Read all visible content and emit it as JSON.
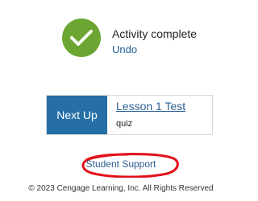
{
  "status": {
    "icon": "checkmark-icon",
    "title": "Activity complete",
    "undo_label": "Undo",
    "success_color": "#6aa631"
  },
  "next_up": {
    "label": "Next Up",
    "lesson_title": "Lesson 1 Test",
    "lesson_type": "quiz",
    "accent_color": "#256ea6"
  },
  "footer": {
    "support_label": "Student Support",
    "copyright": "© 2023 Cengage Learning, Inc. All Rights Reserved"
  },
  "annotation": {
    "shape": "red-oval",
    "color": "#e0101a"
  }
}
